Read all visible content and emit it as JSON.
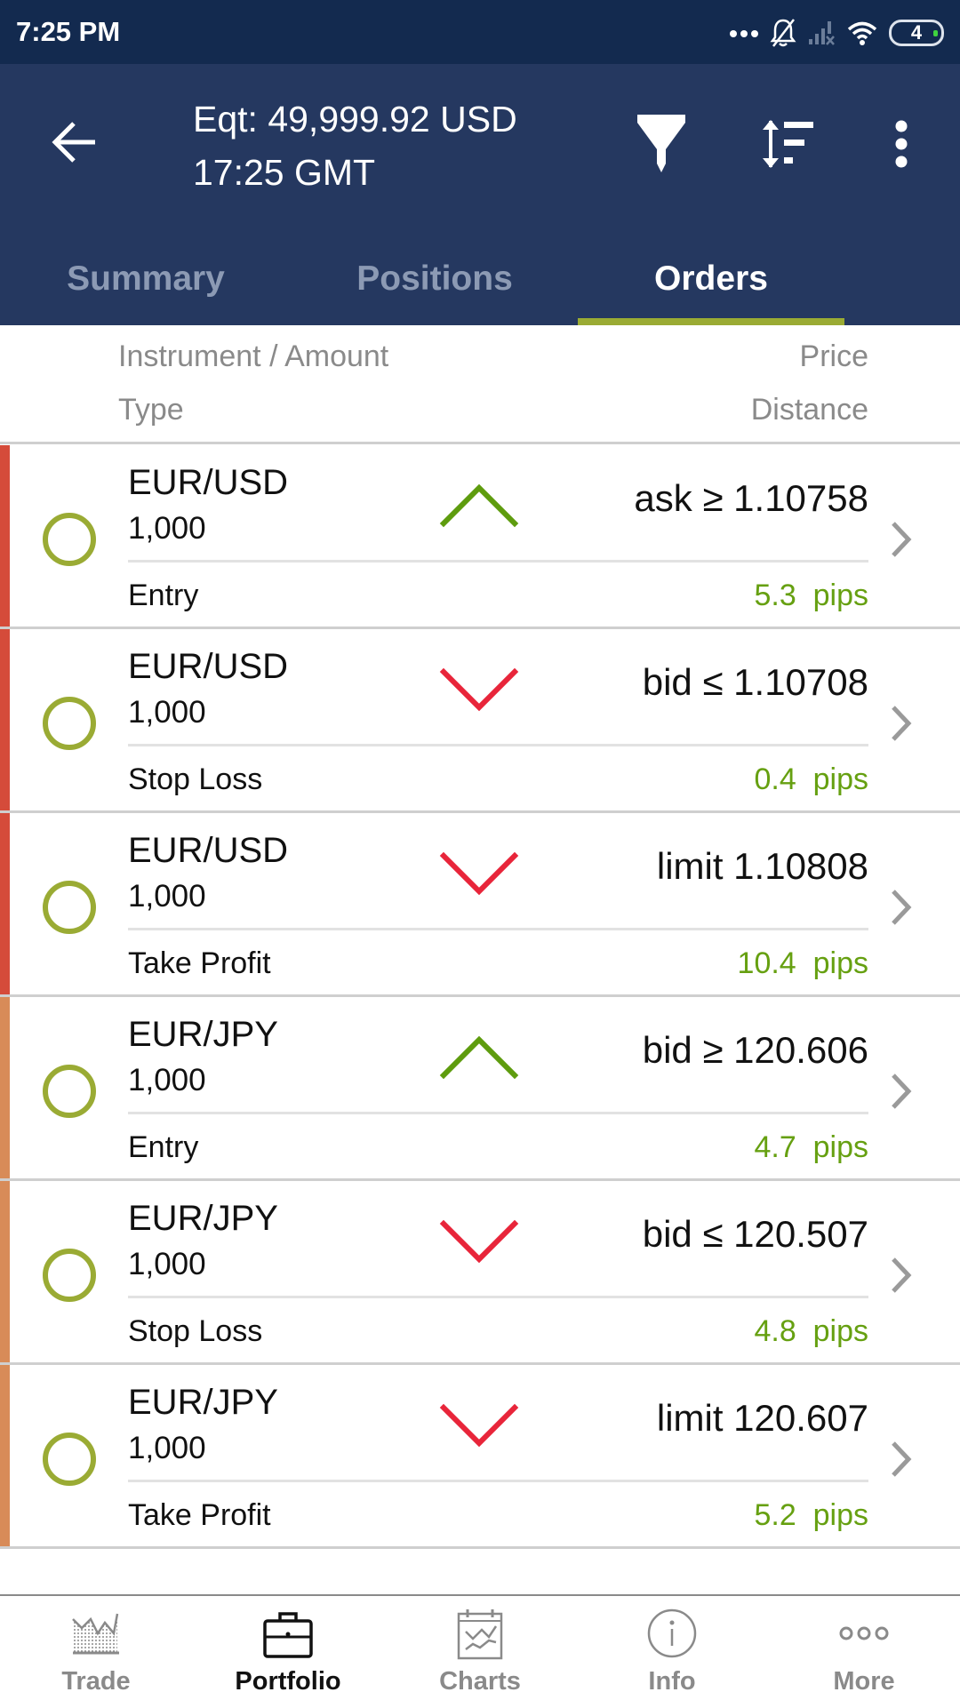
{
  "status_bar": {
    "time": "7:25 PM",
    "battery_level": "4",
    "icons": [
      "more-notifications-icon",
      "bell-muted-icon",
      "signal-off-icon",
      "wifi-icon",
      "battery-icon"
    ]
  },
  "header": {
    "equity": "Eqt: 49,999.92 USD",
    "time": "17:25 GMT",
    "actions": [
      "back-icon",
      "filter-icon",
      "sort-icon",
      "more-vert-icon"
    ]
  },
  "tabs": [
    {
      "label": "Summary",
      "active": false
    },
    {
      "label": "Positions",
      "active": false
    },
    {
      "label": "Orders",
      "active": true
    }
  ],
  "columns": {
    "instrument_amount": "Instrument / Amount",
    "type": "Type",
    "price": "Price",
    "distance": "Distance"
  },
  "colors": {
    "header_bg": "#253860",
    "status_bg": "#132a4f",
    "tab_indicator": "#9aab34",
    "up": "#5e9c0e",
    "down": "#e8253a",
    "pips": "#66a011",
    "eurusd_bar": "#d54b3a",
    "eurjpy_bar": "#d88b58"
  },
  "orders": [
    {
      "instrument": "EUR/USD",
      "amount": "1,000",
      "direction": "up",
      "price": "ask ≥ 1.10758",
      "type": "Entry",
      "distance": "5.3  pips",
      "bar_color": "#d54b3a"
    },
    {
      "instrument": "EUR/USD",
      "amount": "1,000",
      "direction": "down",
      "price": "bid ≤ 1.10708",
      "type": "Stop Loss",
      "distance": "0.4  pips",
      "bar_color": "#d54b3a"
    },
    {
      "instrument": "EUR/USD",
      "amount": "1,000",
      "direction": "down",
      "price": "limit 1.10808",
      "type": "Take Profit",
      "distance": "10.4  pips",
      "bar_color": "#d54b3a"
    },
    {
      "instrument": "EUR/JPY",
      "amount": "1,000",
      "direction": "up",
      "price": "bid ≥ 120.606",
      "type": "Entry",
      "distance": "4.7  pips",
      "bar_color": "#d88b58"
    },
    {
      "instrument": "EUR/JPY",
      "amount": "1,000",
      "direction": "down",
      "price": "bid ≤ 120.507",
      "type": "Stop Loss",
      "distance": "4.8  pips",
      "bar_color": "#d88b58"
    },
    {
      "instrument": "EUR/JPY",
      "amount": "1,000",
      "direction": "down",
      "price": "limit 120.607",
      "type": "Take Profit",
      "distance": "5.2  pips",
      "bar_color": "#d88b58"
    }
  ],
  "bottom_nav": [
    {
      "label": "Trade",
      "icon": "trade-chart-icon",
      "active": false
    },
    {
      "label": "Portfolio",
      "icon": "briefcase-icon",
      "active": true
    },
    {
      "label": "Charts",
      "icon": "charts-calendar-icon",
      "active": false
    },
    {
      "label": "Info",
      "icon": "info-icon",
      "active": false
    },
    {
      "label": "More",
      "icon": "more-dots-icon",
      "active": false
    }
  ]
}
